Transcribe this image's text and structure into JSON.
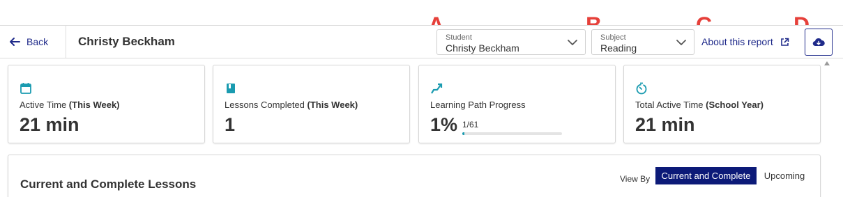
{
  "header": {
    "back_label": "Back",
    "title": "Christy Beckham",
    "student_select": {
      "label": "Student",
      "value": "Christy Beckham"
    },
    "subject_select": {
      "label": "Subject",
      "value": "Reading"
    },
    "about_link": "About this report",
    "download_icon": "cloud-download-icon"
  },
  "markers": {
    "a": "A",
    "b": "B",
    "c": "C",
    "d": "D"
  },
  "cards": [
    {
      "icon": "calendar-icon",
      "label_prefix": "Active Time ",
      "label_bold": "(This Week)",
      "value": "21 min"
    },
    {
      "icon": "book-icon",
      "label_prefix": "Lessons Completed ",
      "label_bold": "(This Week)",
      "value": "1"
    },
    {
      "icon": "path-arrow-icon",
      "label_prefix": "Learning Path Progress",
      "label_bold": "",
      "value": "1%",
      "fraction": "1/61",
      "progress": 0.0164
    },
    {
      "icon": "stopwatch-icon",
      "label_prefix": "Total Active Time ",
      "label_bold": "(School Year)",
      "value": "21 min"
    }
  ],
  "lessons": {
    "title": "Current and Complete Lessons",
    "view_by_label": "View By",
    "toggle_current": "Current and Complete",
    "toggle_upcoming": "Upcoming"
  },
  "colors": {
    "accent": "#1f2a8a",
    "icon": "#1a9bb0",
    "marker": "#e6403a",
    "toggle_active": "#0c1a78"
  }
}
